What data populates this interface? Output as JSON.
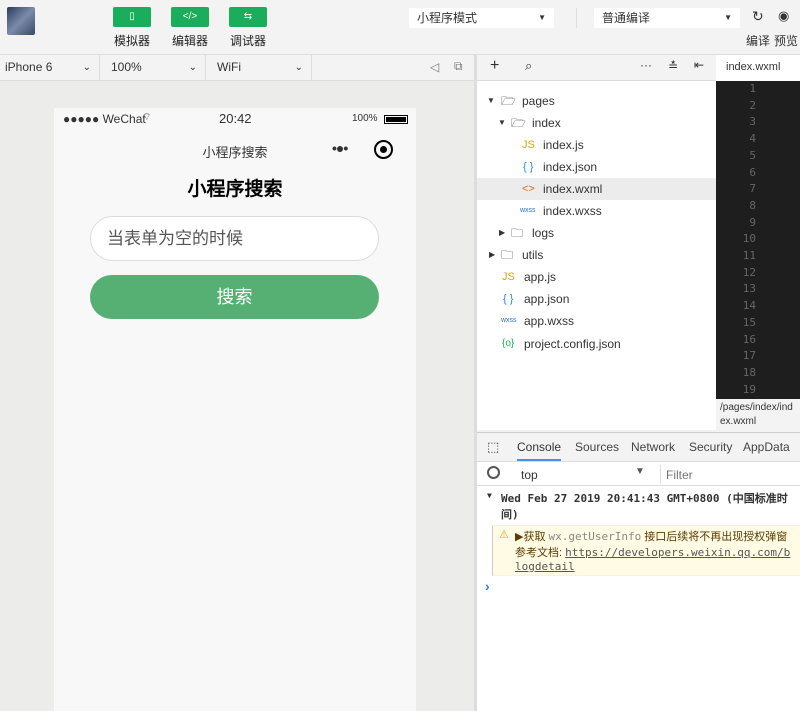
{
  "toolbar": {
    "buttons": [
      {
        "label": "模拟器",
        "icon": "phone-icon"
      },
      {
        "label": "编辑器",
        "icon": "code-icon"
      },
      {
        "label": "调试器",
        "icon": "debug-icon"
      }
    ],
    "mode_select": "小程序模式",
    "compile_select": "普通编译",
    "compile_label": "编译",
    "preview_label": "预览",
    "accent": "#1aad5b"
  },
  "simbar": {
    "device": "iPhone 6",
    "zoom": "100%",
    "network": "WiFi"
  },
  "editor_tab": "index.wxml",
  "editor_path": "/pages/index/index.wxml",
  "line_numbers": [
    "1",
    "2",
    "3",
    "4",
    "5",
    "6",
    "7",
    "8",
    "9",
    "10",
    "11",
    "12",
    "13",
    "14",
    "15",
    "16",
    "17",
    "18",
    "19"
  ],
  "phone": {
    "carrier": "●●●●● WeChat",
    "time": "20:42",
    "battery": "100%",
    "nav_title": "小程序搜索",
    "page_title": "小程序搜索",
    "input_placeholder": "当表单为空的时候",
    "search_button": "搜索",
    "button_color": "#56b074"
  },
  "tree": [
    {
      "label": "pages",
      "type": "folder",
      "open": true,
      "depth": 0
    },
    {
      "label": "index",
      "type": "folder",
      "open": true,
      "depth": 1
    },
    {
      "label": "index.js",
      "type": "js",
      "depth": 2
    },
    {
      "label": "index.json",
      "type": "json",
      "depth": 2
    },
    {
      "label": "index.wxml",
      "type": "wxml",
      "depth": 2,
      "selected": true
    },
    {
      "label": "index.wxss",
      "type": "wxss",
      "depth": 2
    },
    {
      "label": "logs",
      "type": "folder",
      "open": false,
      "depth": 1
    },
    {
      "label": "utils",
      "type": "folder",
      "open": false,
      "depth": 0
    },
    {
      "label": "app.js",
      "type": "js",
      "depth": 0
    },
    {
      "label": "app.json",
      "type": "json",
      "depth": 0
    },
    {
      "label": "app.wxss",
      "type": "wxss",
      "depth": 0
    },
    {
      "label": "project.config.json",
      "type": "config",
      "depth": 0
    }
  ],
  "devtools": {
    "tabs": [
      "Console",
      "Sources",
      "Network",
      "Security",
      "AppData"
    ],
    "active_tab": "Console",
    "context": "top",
    "filter_placeholder": "Filter",
    "group_header": "Wed Feb 27 2019 20:41:43 GMT+0800 (中国标准时间)",
    "warning_line1_prefix": "▶获取 ",
    "warning_code": "wx.getUserInfo",
    "warning_line1_suffix": " 接口后续将不再出现授权弹窗",
    "warning_line2_prefix": "参考文档: ",
    "warning_link": "https://developers.weixin.qq.com/blogdetail",
    "prompt": "›"
  }
}
